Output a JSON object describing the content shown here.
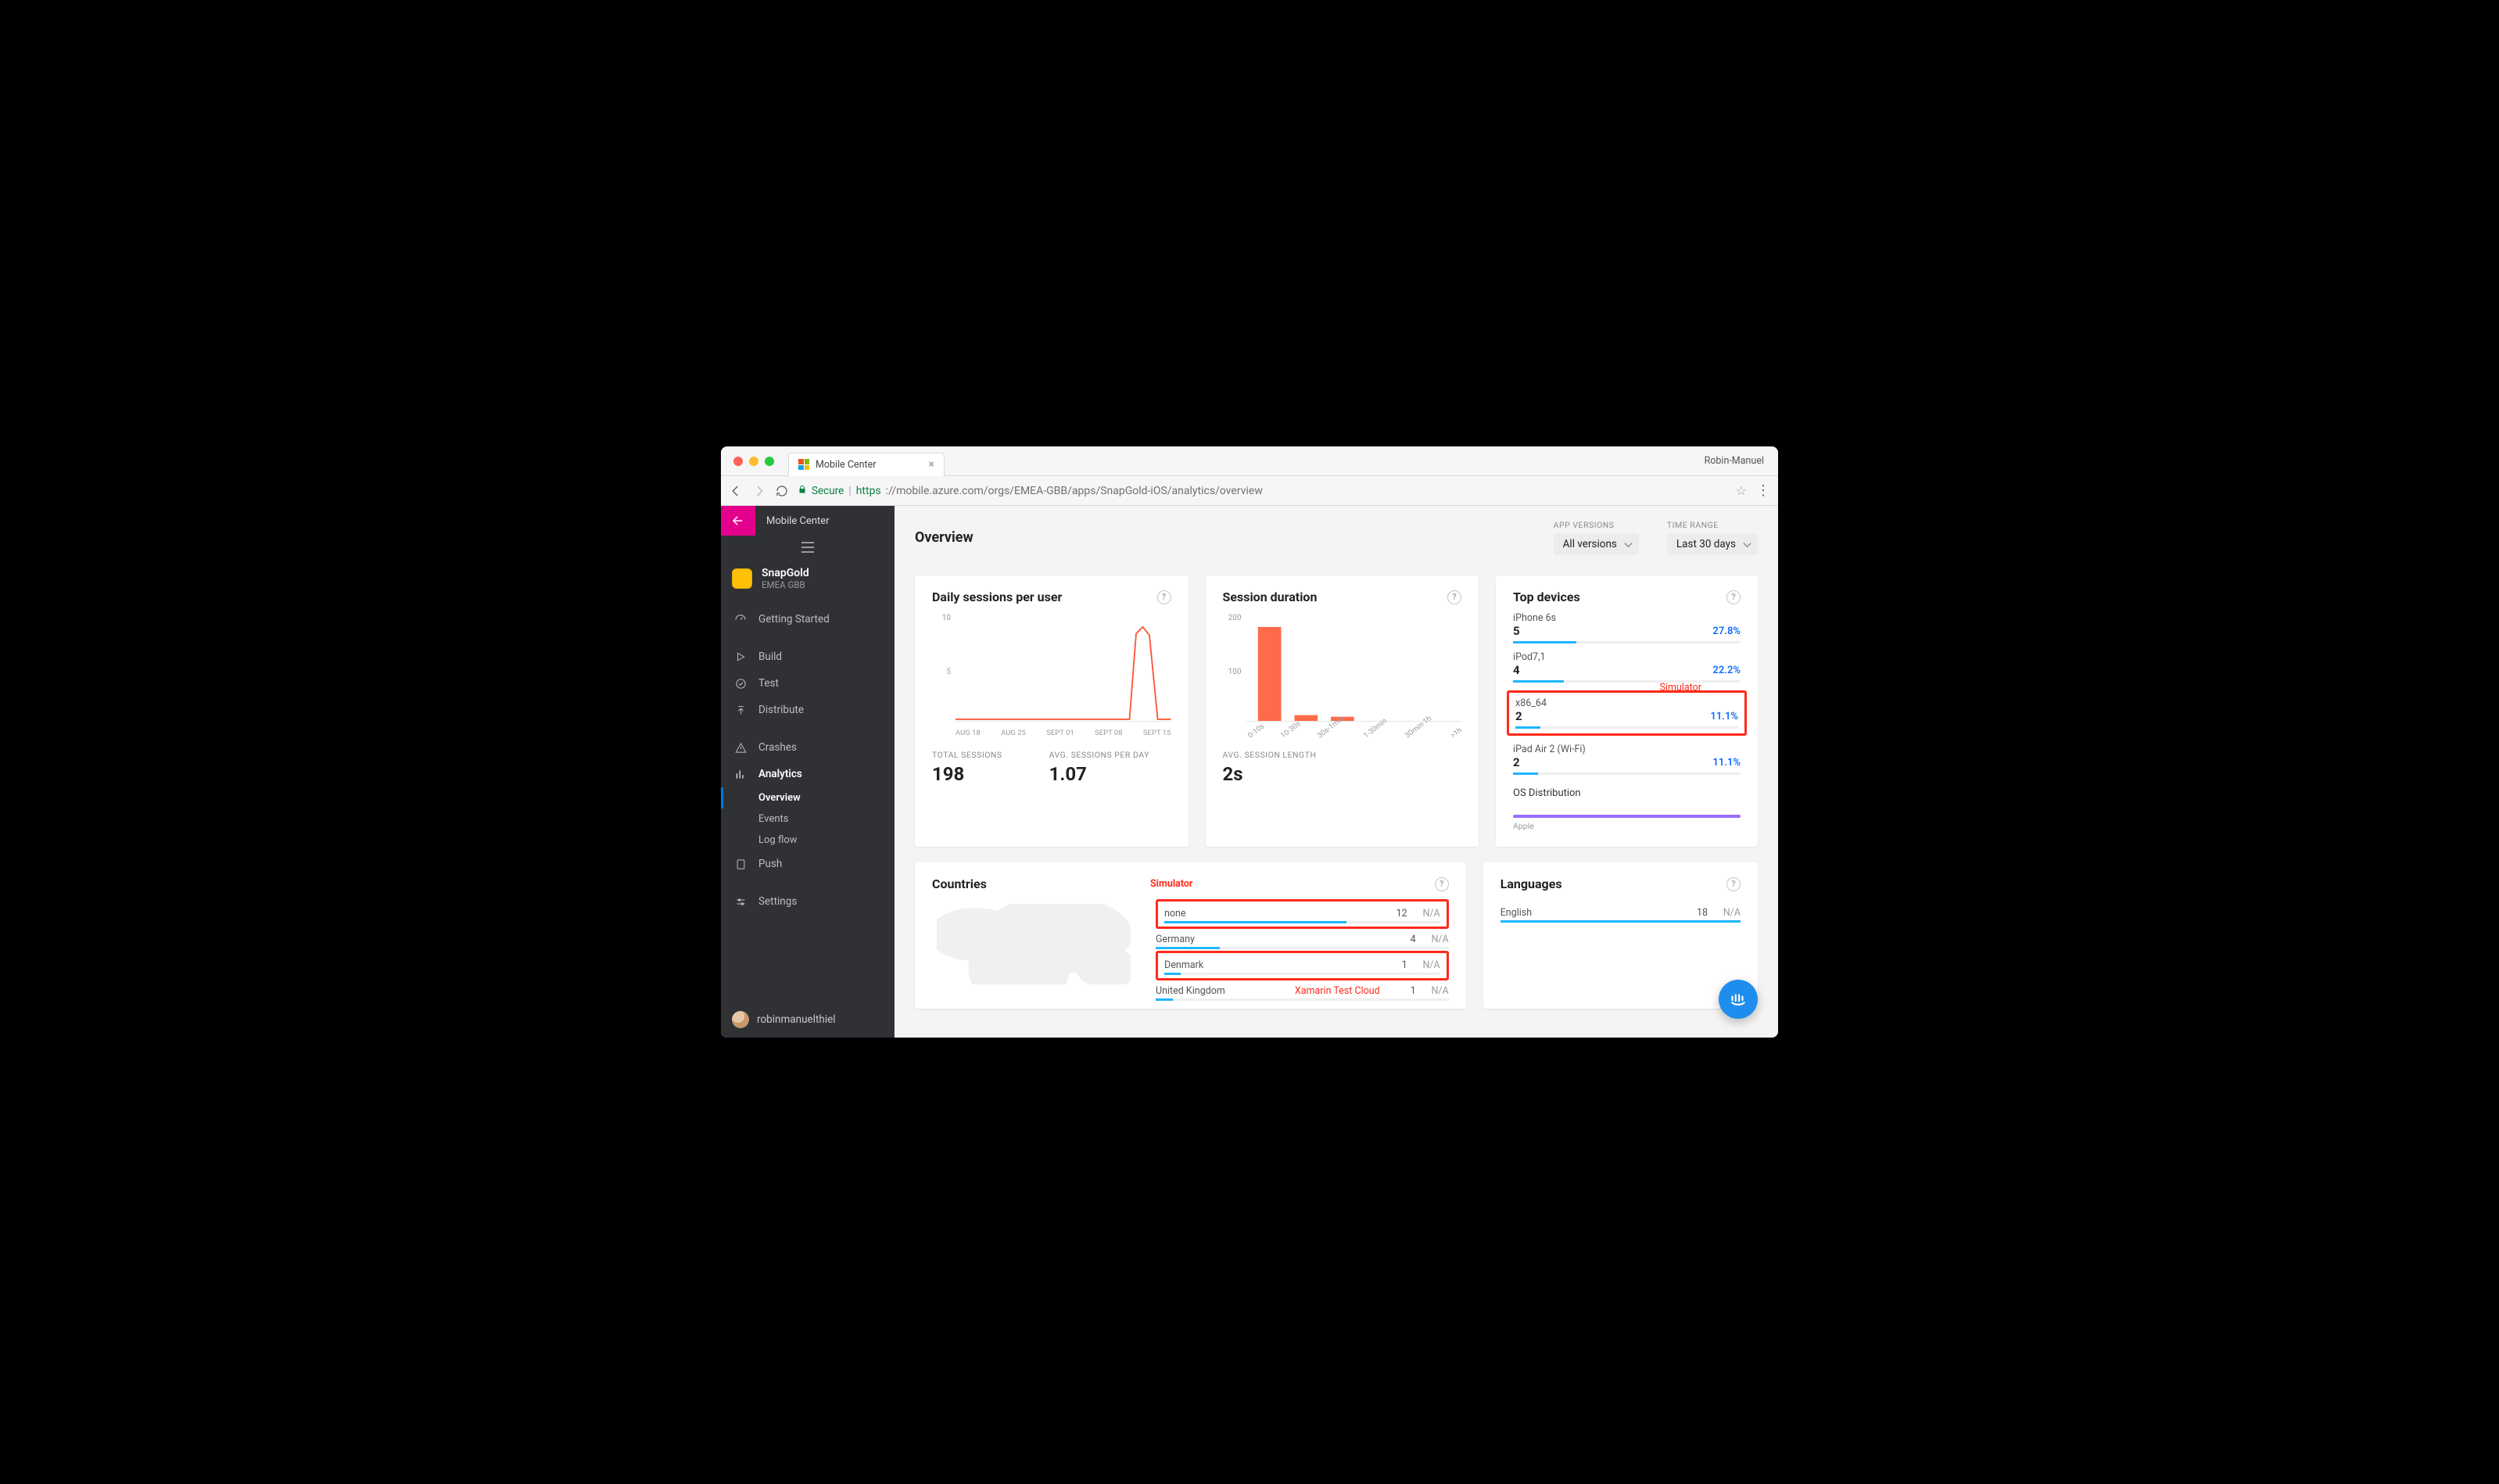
{
  "browser": {
    "tab_title": "Mobile Center",
    "profile": "Robin-Manuel",
    "secure_label": "Secure",
    "url_https": "https",
    "url_rest": "://mobile.azure.com/orgs/EMEA-GBB/apps/SnapGold-iOS/analytics/overview"
  },
  "sidebar": {
    "title": "Mobile Center",
    "app": {
      "name": "SnapGold",
      "org": "EMEA GBB"
    },
    "items": {
      "getting_started": "Getting Started",
      "build": "Build",
      "test": "Test",
      "distribute": "Distribute",
      "crashes": "Crashes",
      "analytics": "Analytics",
      "push": "Push",
      "settings": "Settings"
    },
    "analytics_subs": {
      "overview": "Overview",
      "events": "Events",
      "logflow": "Log flow"
    },
    "user": "robinmanuelthiel"
  },
  "header": {
    "page_title": "Overview",
    "versions_label": "APP VERSIONS",
    "versions_value": "All versions",
    "range_label": "TIME RANGE",
    "range_value": "Last 30 days"
  },
  "cards": {
    "sessions": {
      "title": "Daily sessions per user",
      "y_max": "10",
      "y_mid": "5",
      "x_labels": [
        "AUG 18",
        "AUG 25",
        "SEPT 01",
        "SEPT 08",
        "SEPT 15"
      ],
      "total_label": "TOTAL SESSIONS",
      "total_value": "198",
      "avg_label": "AVG. SESSIONS PER DAY",
      "avg_value": "1.07"
    },
    "duration": {
      "title": "Session duration",
      "y_max": "200",
      "y_mid": "100",
      "x_labels": [
        "0-10s",
        "10-30s",
        "30s-1min",
        "1-30min",
        "30min-1h",
        ">1h"
      ],
      "avg_label": "AVG. SESSION LENGTH",
      "avg_value": "2s"
    },
    "devices": {
      "title": "Top devices",
      "rows": [
        {
          "name": "iPhone 6s",
          "count": "5",
          "pct": "27.8%"
        },
        {
          "name": "iPod7,1",
          "count": "4",
          "pct": "22.2%"
        },
        {
          "name": "x86_64",
          "count": "2",
          "pct": "11.1%"
        },
        {
          "name": "iPad Air 2 (Wi-Fi)",
          "count": "2",
          "pct": "11.1%"
        }
      ],
      "anno_simulator": "Simulator",
      "osdist_title": "OS Distribution",
      "osdist_label": "Apple"
    },
    "countries": {
      "title": "Countries",
      "anno_simulator": "Simulator",
      "anno_xtc": "Xamarin Test Cloud",
      "rows": [
        {
          "name": "none",
          "value": "12",
          "na": "N/A"
        },
        {
          "name": "Germany",
          "value": "4",
          "na": "N/A"
        },
        {
          "name": "Denmark",
          "value": "1",
          "na": "N/A"
        },
        {
          "name": "United Kingdom",
          "value": "1",
          "na": "N/A"
        }
      ]
    },
    "languages": {
      "title": "Languages",
      "rows": [
        {
          "name": "English",
          "value": "18",
          "na": "N/A"
        }
      ]
    }
  },
  "chart_data": [
    {
      "type": "line",
      "title": "Daily sessions per user",
      "xlabel": "",
      "ylabel": "",
      "ylim": [
        0,
        10
      ],
      "categories": [
        "AUG 18",
        "AUG 25",
        "SEPT 01",
        "SEPT 08",
        "SEPT 15"
      ],
      "series": [
        {
          "name": "sessions",
          "values": [
            0,
            0,
            0,
            0,
            0,
            0,
            0,
            0,
            0,
            0,
            0,
            0,
            0,
            0,
            0,
            0,
            0,
            0,
            0,
            0,
            0,
            0,
            0,
            0,
            0,
            0,
            8,
            9,
            8,
            0
          ]
        }
      ]
    },
    {
      "type": "bar",
      "title": "Session duration",
      "xlabel": "",
      "ylabel": "",
      "ylim": [
        0,
        200
      ],
      "categories": [
        "0-10s",
        "10-30s",
        "30s-1min",
        "1-30min",
        "30min-1h",
        ">1h"
      ],
      "values": [
        175,
        10,
        8,
        0,
        0,
        0
      ]
    }
  ]
}
